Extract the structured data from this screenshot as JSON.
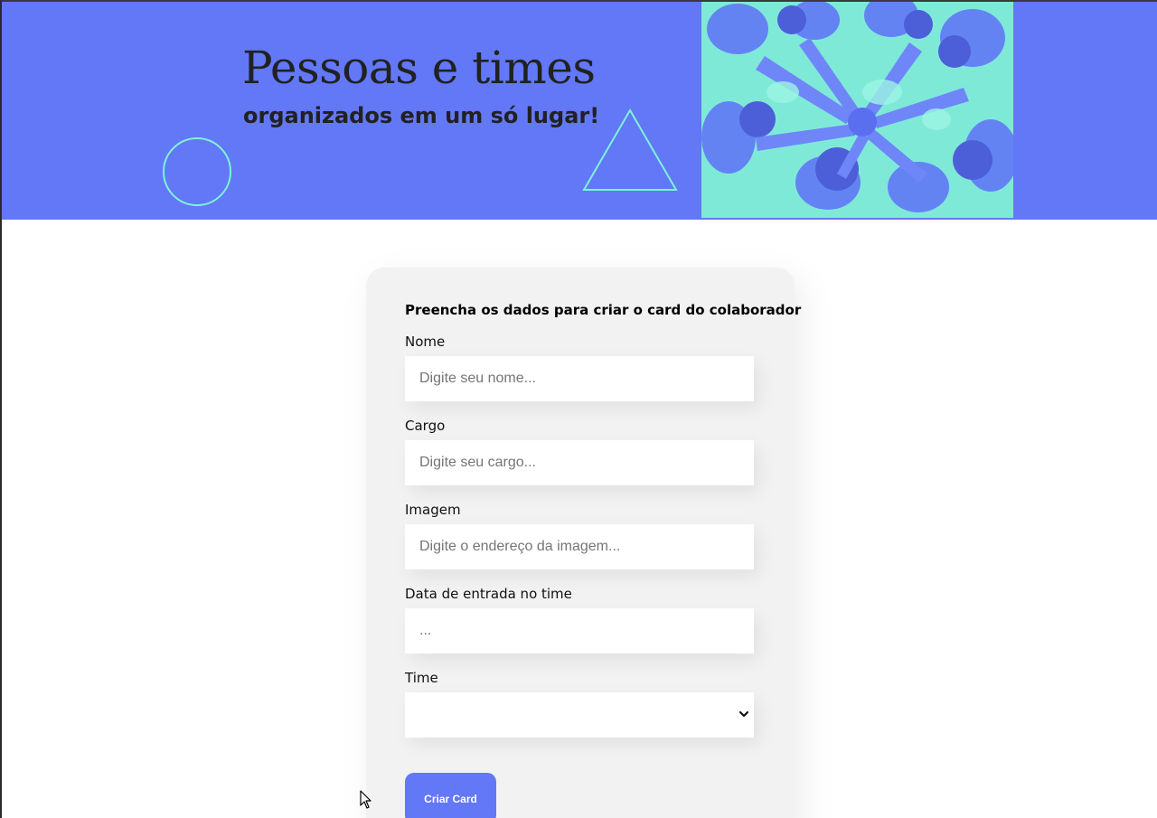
{
  "banner": {
    "title": "Pessoas e times",
    "subtitle": "organizados em um só lugar!",
    "background_color": "#6278f7",
    "accent_color": "#7ef3d6",
    "photo_icon": "team-hands-photo"
  },
  "form": {
    "heading": "Preencha os dados para criar o card do colaborador",
    "fields": [
      {
        "label": "Nome",
        "placeholder": "Digite seu nome...",
        "value": ""
      },
      {
        "label": "Cargo",
        "placeholder": "Digite seu cargo...",
        "value": ""
      },
      {
        "label": "Imagem",
        "placeholder": "Digite o endereço da imagem...",
        "value": ""
      },
      {
        "label": "Data de entrada no time",
        "placeholder": "...",
        "value": ""
      }
    ],
    "team_select": {
      "label": "Time",
      "selected": ""
    },
    "submit_label": "Criar Card",
    "button_color": "#6278f7"
  }
}
